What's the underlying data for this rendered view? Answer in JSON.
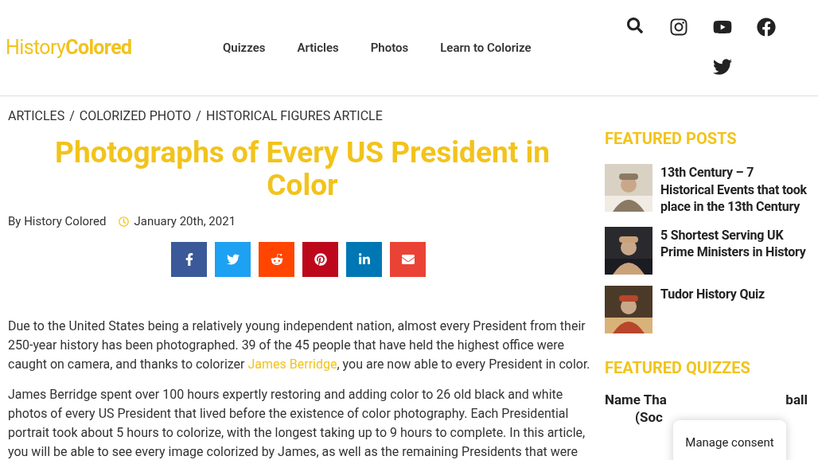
{
  "header": {
    "logo": {
      "light": "History",
      "bold": "Colored"
    },
    "nav": [
      "Quizzes",
      "Articles",
      "Photos",
      "Learn to Colorize"
    ],
    "icons": [
      {
        "kind": "search"
      },
      {
        "kind": "instagram"
      },
      {
        "kind": "youtube"
      },
      {
        "kind": "facebook"
      },
      {
        "kind": "twitter"
      }
    ]
  },
  "breadcrumb": [
    "ARTICLES",
    "COLORIZED PHOTO",
    "HISTORICAL FIGURES ARTICLE"
  ],
  "breadcrumb_separator": "/",
  "article": {
    "title": "Photographs of Every US President in Color",
    "author": "By History Colored",
    "date": "January 20th, 2021",
    "share": [
      {
        "kind": "facebook",
        "color": "#3b5998"
      },
      {
        "kind": "twitter",
        "color": "#1da1f2"
      },
      {
        "kind": "reddit",
        "color": "#ff4500"
      },
      {
        "kind": "pinterest",
        "color": "#bd081c"
      },
      {
        "kind": "linkedin",
        "color": "#0077b5"
      },
      {
        "kind": "email",
        "color": "#ea4335"
      }
    ],
    "paragraphs": [
      [
        {
          "text": "Due to the United States being a relatively young independent nation, almost every President from their 250-year history has been photographed. 39 of the 45 people that have held the highest office were caught on camera, and thanks to colorizer "
        },
        {
          "text": "James Berridge",
          "link": true
        },
        {
          "text": ", you are now able to every President in color."
        }
      ],
      [
        {
          "text": "James Berridge spent over 100 hours expertly restoring and adding color to 26 old black and white photos of every US President that lived before the existence of color photography. Each Presidential portrait took about 5 hours to colorize, with the longest taking up to 9 hours to complete. In this article, you will be able to see every image colorized by James, as well as the remaining Presidents that were"
        }
      ]
    ]
  },
  "sidebar": {
    "featured_posts_heading": "FEATURED POSTS",
    "posts": [
      {
        "title": "13th Century – 7 Historical Events that took place in the 13th Century",
        "kind": "picture"
      },
      {
        "title": "5 Shortest Serving UK Prime Ministers in History",
        "kind": "picture"
      },
      {
        "title": "Tudor History Quiz",
        "kind": "picture"
      }
    ],
    "featured_quizzes_heading": "FEATURED QUIZZES",
    "quiz_title_visible": {
      "line1_left": "Name Tha",
      "line1_right": "ball",
      "line2": "(Soc"
    }
  },
  "consent_button": "Manage consent"
}
